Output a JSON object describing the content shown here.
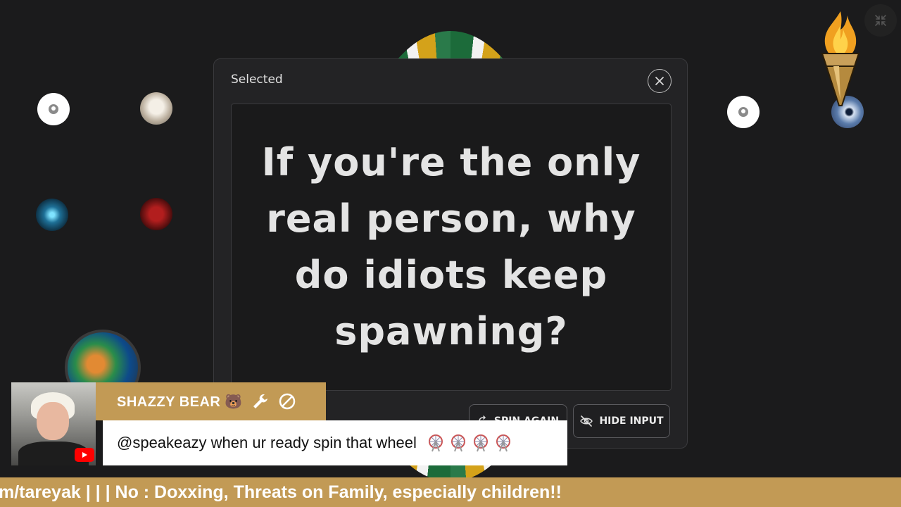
{
  "modal": {
    "title": "Selected",
    "selected_text": "If you're the only real person, why do idiots keep spawning?",
    "spin_again_label": "SPIN AGAIN",
    "hide_input_label": "HIDE INPUT"
  },
  "chat": {
    "username": "SHAZZY BEAR 🐻",
    "message": "@speakeazy when ur ready spin that wheel",
    "platform_icon": "youtube-icon"
  },
  "ticker": {
    "text": "m/tareyak | | | No : Doxxing, Threats on Family, especially children!!"
  },
  "colors": {
    "background": "#1b1b1c",
    "modal": "#232325",
    "accent_gold": "#c29a55",
    "youtube_red": "#ff0000"
  },
  "icons": [
    "close-icon",
    "spin-icon",
    "eye-off-icon",
    "collapse-icon",
    "wrench-icon",
    "ban-icon",
    "ferris-wheel-icon",
    "torch-logo"
  ]
}
